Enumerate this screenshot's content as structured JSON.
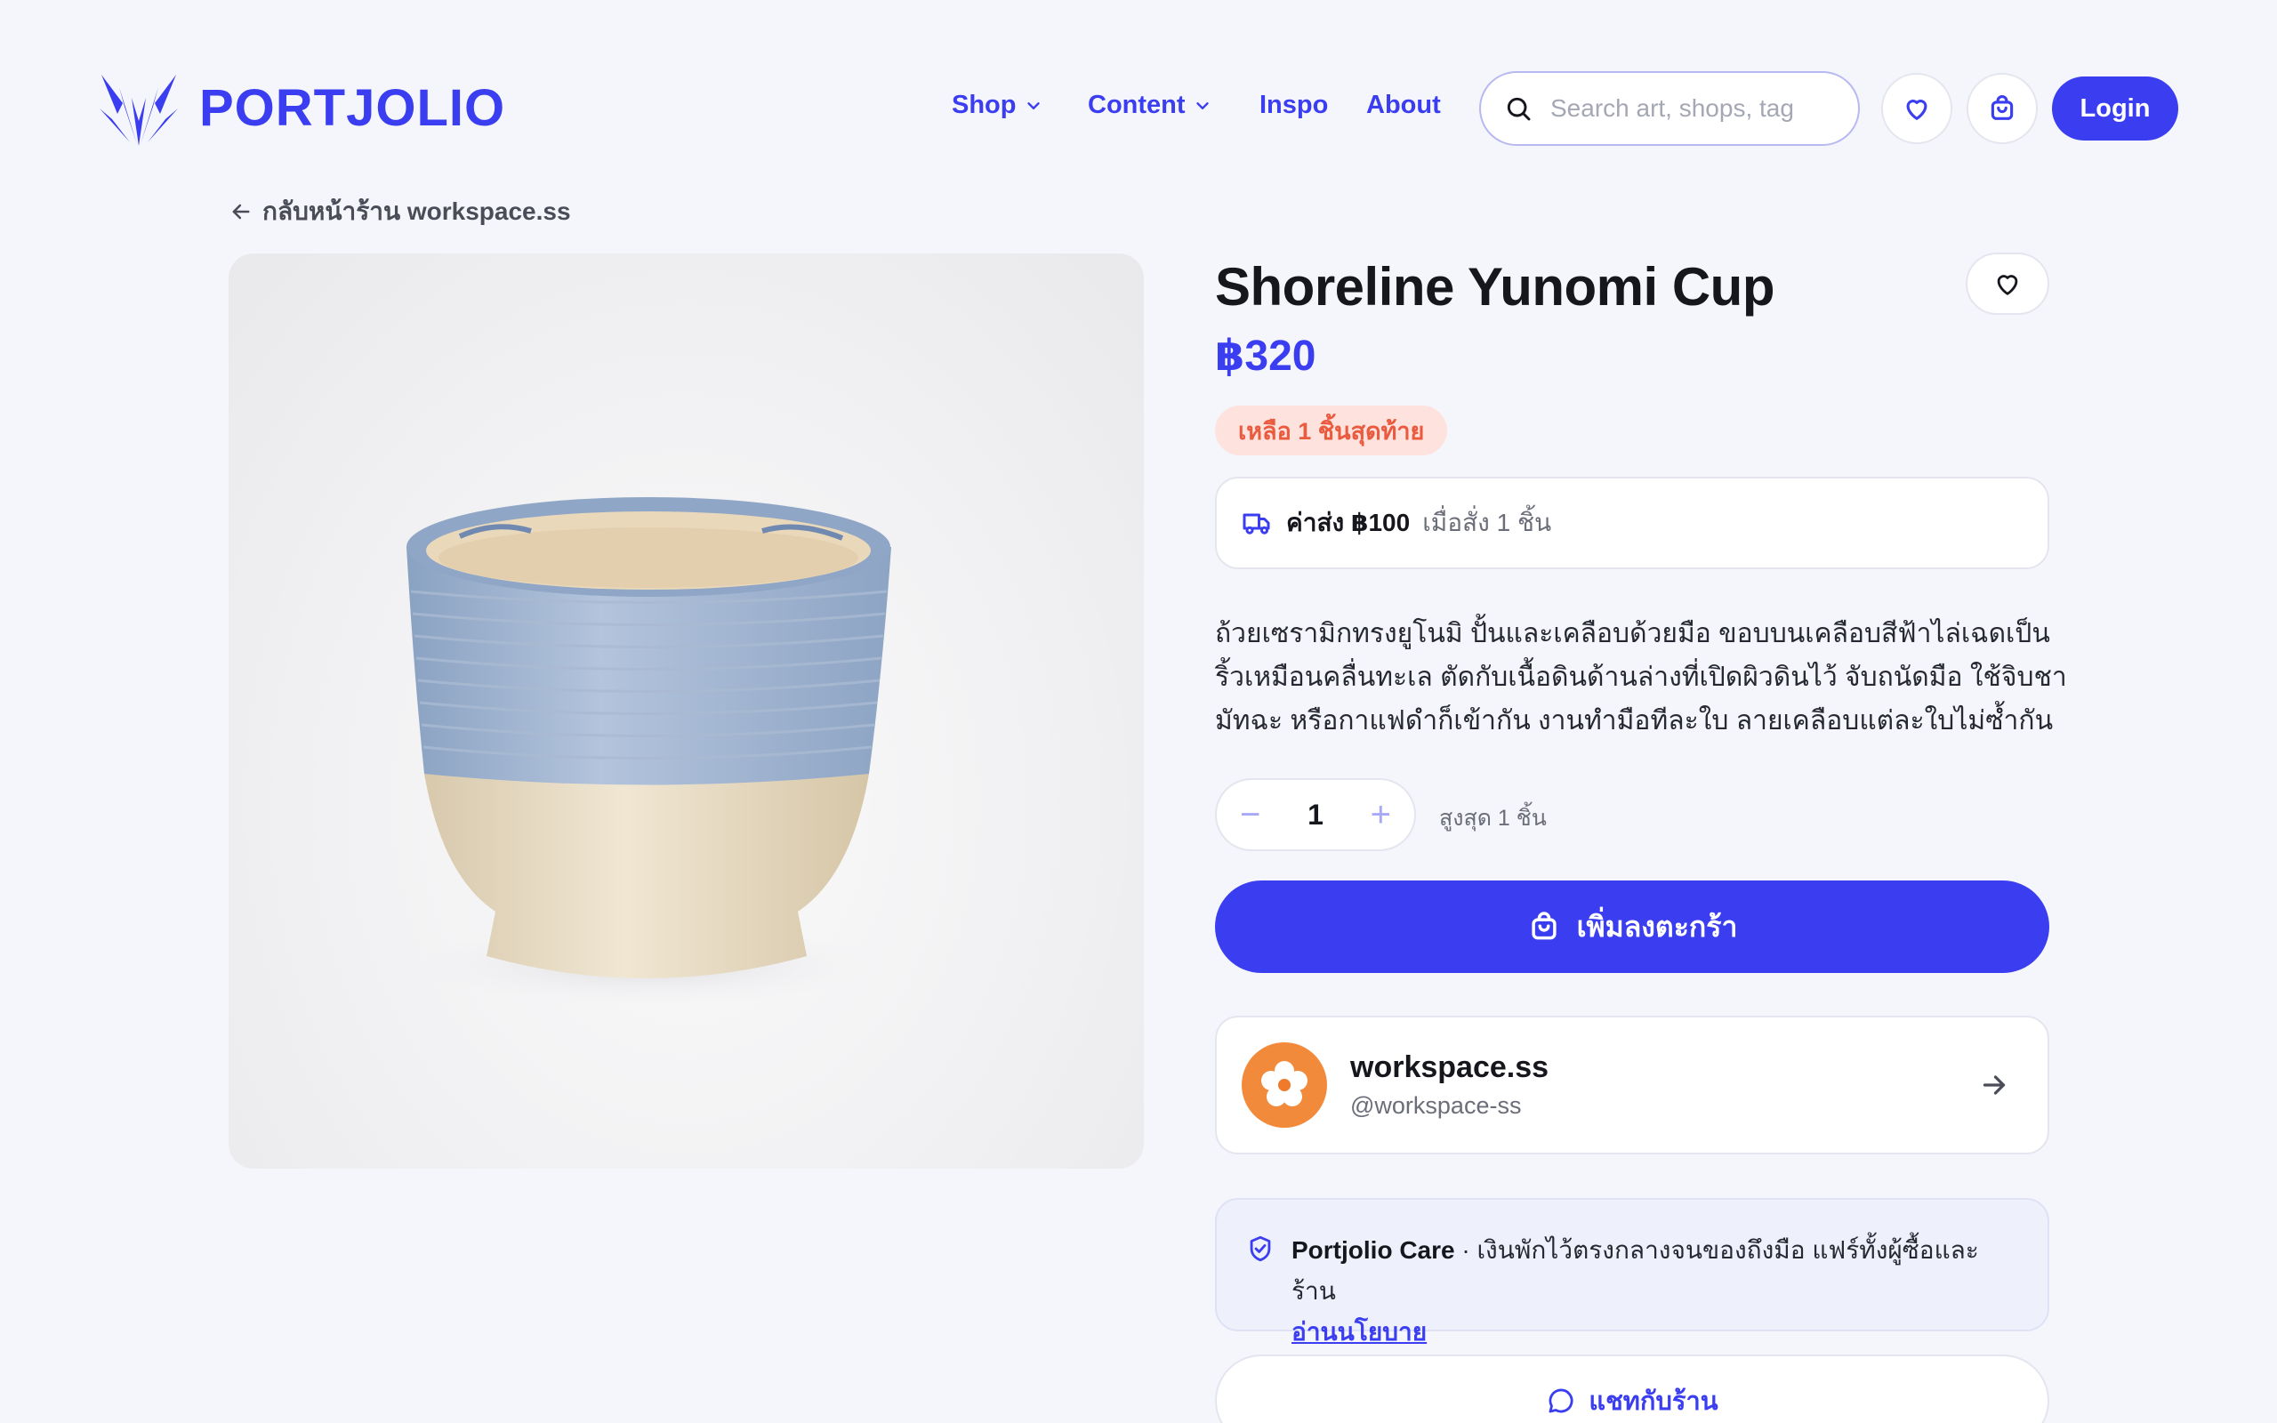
{
  "brand": {
    "name": "PORTJOLIO"
  },
  "nav": {
    "items": [
      {
        "label": "Shop",
        "has_dropdown": true
      },
      {
        "label": "Content",
        "has_dropdown": true
      },
      {
        "label": "Inspo",
        "has_dropdown": false
      },
      {
        "label": "About",
        "has_dropdown": false
      }
    ]
  },
  "search": {
    "placeholder": "Search art, shops, tag",
    "value": ""
  },
  "header": {
    "login_label": "Login",
    "icons": [
      "heart-icon",
      "cart-icon",
      "search-icon"
    ]
  },
  "back_link": {
    "label": "กลับหน้าร้าน workspace.ss"
  },
  "product": {
    "title": "Shoreline Yunomi Cup",
    "price": "฿320",
    "stock_badge": "เหลือ 1 ชิ้นสุดท้าย",
    "shipping": {
      "strong": "ค่าส่ง ฿100",
      "muted": "เมื่อสั่ง 1 ชิ้น"
    },
    "description": "ถ้วยเซรามิกทรงยูโนมิ ปั้นและเคลือบด้วยมือ ขอบบนเคลือบสีฟ้าไล่เฉดเป็นริ้วเหมือนคลื่นทะเล ตัดกับเนื้อดินด้านล่างที่เปิดผิวดินไว้ จับถนัดมือ ใช้จิบชา มัทฉะ หรือกาแฟดำก็เข้ากัน งานทำมือทีละใบ ลายเคลือบแต่ละใบไม่ซ้ำกัน",
    "quantity": {
      "minus": "−",
      "value": "1",
      "plus": "+",
      "max_note": "สูงสุด 1 ชิ้น"
    },
    "add_to_cart_label": "เพิ่มลงตะกร้า"
  },
  "shop": {
    "name": "workspace.ss",
    "handle": "@workspace-ss"
  },
  "care": {
    "brand": "Portjolio Care",
    "text": " · เงินพักไว้ตรงกลางจนของถึงมือ แฟร์ทั้งผู้ซื้อและร้าน",
    "link": "อ่านนโยบาย"
  },
  "chat": {
    "label": "แชทกับร้าน"
  },
  "colors": {
    "accent": "#3b3ef0",
    "background": "#f5f6fb",
    "badge_bg": "#fde2dd",
    "badge_text": "#ea5a3f",
    "avatar_bg": "#f28a3b"
  }
}
